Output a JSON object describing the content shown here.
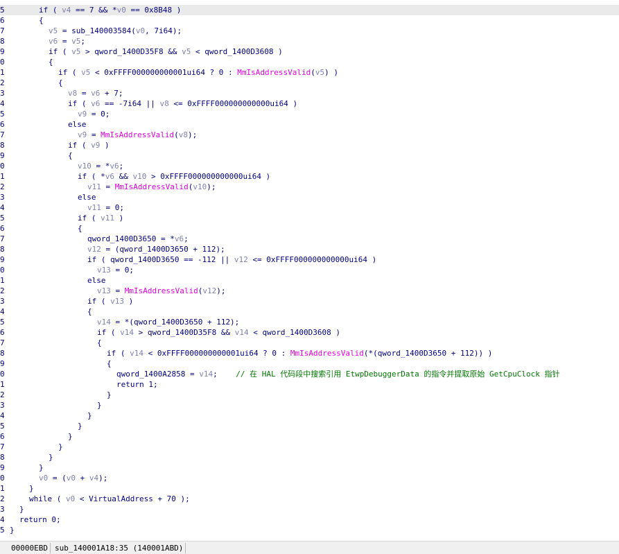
{
  "code_lines": [
    {
      "n": "5",
      "indent": 3,
      "tokens": [
        [
          "p",
          "if ( "
        ],
        [
          "v",
          "v4"
        ],
        [
          "p",
          " == 7 && *"
        ],
        [
          "v",
          "v0"
        ],
        [
          "p",
          " == 0x8B48 )"
        ]
      ]
    },
    {
      "n": "6",
      "indent": 3,
      "tokens": [
        [
          "p",
          "{"
        ]
      ]
    },
    {
      "n": "7",
      "indent": 4,
      "tokens": [
        [
          "v",
          "v5"
        ],
        [
          "p",
          " = sub_140003584("
        ],
        [
          "v",
          "v0"
        ],
        [
          "p",
          ", 7i64);"
        ]
      ]
    },
    {
      "n": "8",
      "indent": 4,
      "tokens": [
        [
          "v",
          "v6"
        ],
        [
          "p",
          " = "
        ],
        [
          "v",
          "v5"
        ],
        [
          "p",
          ";"
        ]
      ]
    },
    {
      "n": "9",
      "indent": 4,
      "tokens": [
        [
          "p",
          "if ( "
        ],
        [
          "v",
          "v5"
        ],
        [
          "p",
          " > qword_1400D35F8 && "
        ],
        [
          "v",
          "v5"
        ],
        [
          "p",
          " < qword_1400D3608 )"
        ]
      ]
    },
    {
      "n": "0",
      "indent": 4,
      "tokens": [
        [
          "p",
          "{"
        ]
      ]
    },
    {
      "n": "1",
      "indent": 5,
      "tokens": [
        [
          "p",
          "if ( "
        ],
        [
          "v",
          "v5"
        ],
        [
          "p",
          " < 0xFFFF000000000001ui64 ? 0 : "
        ],
        [
          "f",
          "MmIsAddressValid"
        ],
        [
          "p",
          "("
        ],
        [
          "v",
          "v5"
        ],
        [
          "p",
          ") )"
        ]
      ]
    },
    {
      "n": "2",
      "indent": 5,
      "tokens": [
        [
          "p",
          "{"
        ]
      ]
    },
    {
      "n": "3",
      "indent": 6,
      "tokens": [
        [
          "v",
          "v8"
        ],
        [
          "p",
          " = "
        ],
        [
          "v",
          "v6"
        ],
        [
          "p",
          " + 7;"
        ]
      ]
    },
    {
      "n": "4",
      "indent": 6,
      "tokens": [
        [
          "p",
          "if ( "
        ],
        [
          "v",
          "v6"
        ],
        [
          "p",
          " == -7i64 || "
        ],
        [
          "v",
          "v8"
        ],
        [
          "p",
          " <= 0xFFFF000000000000ui64 )"
        ]
      ]
    },
    {
      "n": "5",
      "indent": 7,
      "tokens": [
        [
          "v",
          "v9"
        ],
        [
          "p",
          " = 0;"
        ]
      ]
    },
    {
      "n": "6",
      "indent": 6,
      "tokens": [
        [
          "p",
          "else"
        ]
      ]
    },
    {
      "n": "7",
      "indent": 7,
      "tokens": [
        [
          "v",
          "v9"
        ],
        [
          "p",
          " = "
        ],
        [
          "f",
          "MmIsAddressValid"
        ],
        [
          "p",
          "("
        ],
        [
          "v",
          "v8"
        ],
        [
          "p",
          ");"
        ]
      ]
    },
    {
      "n": "8",
      "indent": 6,
      "tokens": [
        [
          "p",
          "if ( "
        ],
        [
          "v",
          "v9"
        ],
        [
          "p",
          " )"
        ]
      ]
    },
    {
      "n": "9",
      "indent": 6,
      "tokens": [
        [
          "p",
          "{"
        ]
      ]
    },
    {
      "n": "0",
      "indent": 7,
      "tokens": [
        [
          "v",
          "v10"
        ],
        [
          "p",
          " = *"
        ],
        [
          "v",
          "v6"
        ],
        [
          "p",
          ";"
        ]
      ]
    },
    {
      "n": "1",
      "indent": 7,
      "tokens": [
        [
          "p",
          "if ( *"
        ],
        [
          "v",
          "v6"
        ],
        [
          "p",
          " && "
        ],
        [
          "v",
          "v10"
        ],
        [
          "p",
          " > 0xFFFF000000000000ui64 )"
        ]
      ]
    },
    {
      "n": "2",
      "indent": 8,
      "tokens": [
        [
          "v",
          "v11"
        ],
        [
          "p",
          " = "
        ],
        [
          "f",
          "MmIsAddressValid"
        ],
        [
          "p",
          "("
        ],
        [
          "v",
          "v10"
        ],
        [
          "p",
          ");"
        ]
      ]
    },
    {
      "n": "3",
      "indent": 7,
      "tokens": [
        [
          "p",
          "else"
        ]
      ]
    },
    {
      "n": "4",
      "indent": 8,
      "tokens": [
        [
          "v",
          "v11"
        ],
        [
          "p",
          " = 0;"
        ]
      ]
    },
    {
      "n": "5",
      "indent": 7,
      "tokens": [
        [
          "p",
          "if ( "
        ],
        [
          "v",
          "v11"
        ],
        [
          "p",
          " )"
        ]
      ]
    },
    {
      "n": "6",
      "indent": 7,
      "tokens": [
        [
          "p",
          "{"
        ]
      ]
    },
    {
      "n": "7",
      "indent": 8,
      "tokens": [
        [
          "p",
          "qword_1400D3650 = *"
        ],
        [
          "v",
          "v6"
        ],
        [
          "p",
          ";"
        ]
      ]
    },
    {
      "n": "8",
      "indent": 8,
      "tokens": [
        [
          "v",
          "v12"
        ],
        [
          "p",
          " = (qword_1400D3650 + 112);"
        ]
      ]
    },
    {
      "n": "9",
      "indent": 8,
      "tokens": [
        [
          "p",
          "if ( qword_1400D3650 == -112 || "
        ],
        [
          "v",
          "v12"
        ],
        [
          "p",
          " <= 0xFFFF000000000000ui64 )"
        ]
      ]
    },
    {
      "n": "0",
      "indent": 9,
      "tokens": [
        [
          "v",
          "v13"
        ],
        [
          "p",
          " = 0;"
        ]
      ]
    },
    {
      "n": "1",
      "indent": 8,
      "tokens": [
        [
          "p",
          "else"
        ]
      ]
    },
    {
      "n": "2",
      "indent": 9,
      "tokens": [
        [
          "v",
          "v13"
        ],
        [
          "p",
          " = "
        ],
        [
          "f",
          "MmIsAddressValid"
        ],
        [
          "p",
          "("
        ],
        [
          "v",
          "v12"
        ],
        [
          "p",
          ");"
        ]
      ]
    },
    {
      "n": "3",
      "indent": 8,
      "tokens": [
        [
          "p",
          "if ( "
        ],
        [
          "v",
          "v13"
        ],
        [
          "p",
          " )"
        ]
      ]
    },
    {
      "n": "4",
      "indent": 8,
      "tokens": [
        [
          "p",
          "{"
        ]
      ]
    },
    {
      "n": "5",
      "indent": 9,
      "tokens": [
        [
          "v",
          "v14"
        ],
        [
          "p",
          " = *(qword_1400D3650 + 112);"
        ]
      ]
    },
    {
      "n": "6",
      "indent": 9,
      "tokens": [
        [
          "p",
          "if ( "
        ],
        [
          "v",
          "v14"
        ],
        [
          "p",
          " > qword_1400D35F8 && "
        ],
        [
          "v",
          "v14"
        ],
        [
          "p",
          " < qword_1400D3608 )"
        ]
      ]
    },
    {
      "n": "7",
      "indent": 9,
      "tokens": [
        [
          "p",
          "{"
        ]
      ]
    },
    {
      "n": "8",
      "indent": 10,
      "tokens": [
        [
          "p",
          "if ( "
        ],
        [
          "v",
          "v14"
        ],
        [
          "p",
          " < 0xFFFF000000000001ui64 ? 0 : "
        ],
        [
          "f",
          "MmIsAddressValid"
        ],
        [
          "p",
          "(*(qword_1400D3650 + 112)) )"
        ]
      ]
    },
    {
      "n": "9",
      "indent": 10,
      "tokens": [
        [
          "p",
          "{"
        ]
      ]
    },
    {
      "n": "0",
      "indent": 11,
      "tokens": [
        [
          "p",
          "qword_1400A2858 = "
        ],
        [
          "v",
          "v14"
        ],
        [
          "p",
          ";    "
        ],
        [
          "c",
          "// 在 HAL 代码段中搜索引用 EtwpDebuggerData 的指令并提取原始 GetCpuClock 指针"
        ]
      ]
    },
    {
      "n": "1",
      "indent": 11,
      "tokens": [
        [
          "p",
          "return 1;"
        ]
      ]
    },
    {
      "n": "2",
      "indent": 10,
      "tokens": [
        [
          "p",
          "}"
        ]
      ]
    },
    {
      "n": "3",
      "indent": 9,
      "tokens": [
        [
          "p",
          "}"
        ]
      ]
    },
    {
      "n": "4",
      "indent": 8,
      "tokens": [
        [
          "p",
          "}"
        ]
      ]
    },
    {
      "n": "5",
      "indent": 7,
      "tokens": [
        [
          "p",
          "}"
        ]
      ]
    },
    {
      "n": "6",
      "indent": 6,
      "tokens": [
        [
          "p",
          "}"
        ]
      ]
    },
    {
      "n": "7",
      "indent": 5,
      "tokens": [
        [
          "p",
          "}"
        ]
      ]
    },
    {
      "n": "8",
      "indent": 4,
      "tokens": [
        [
          "p",
          "}"
        ]
      ]
    },
    {
      "n": "9",
      "indent": 3,
      "tokens": [
        [
          "p",
          "}"
        ]
      ]
    },
    {
      "n": "0",
      "indent": 3,
      "tokens": [
        [
          "v",
          "v0"
        ],
        [
          "p",
          " = ("
        ],
        [
          "v",
          "v0"
        ],
        [
          "p",
          " + "
        ],
        [
          "v",
          "v4"
        ],
        [
          "p",
          ");"
        ]
      ]
    },
    {
      "n": "1",
      "indent": 2,
      "tokens": [
        [
          "p",
          "}"
        ]
      ]
    },
    {
      "n": "2",
      "indent": 2,
      "tokens": [
        [
          "p",
          "while ( "
        ],
        [
          "v",
          "v0"
        ],
        [
          "p",
          " < VirtualAddress + 70 );"
        ]
      ]
    },
    {
      "n": "3",
      "indent": 1,
      "tokens": [
        [
          "p",
          "}"
        ]
      ]
    },
    {
      "n": "4",
      "indent": 1,
      "tokens": [
        [
          "p",
          "return 0;"
        ]
      ]
    },
    {
      "n": "5",
      "indent": 0,
      "tokens": [
        [
          "p",
          "}"
        ]
      ]
    }
  ],
  "status_bar": {
    "address": "00000EBD",
    "location": "sub_140001A18:35 (140001ABD)"
  },
  "colors": {
    "plain": "#000080",
    "variable": "#8080b0",
    "function": "#e000e0",
    "comment": "#007700",
    "current_line": "#eaeaea"
  }
}
